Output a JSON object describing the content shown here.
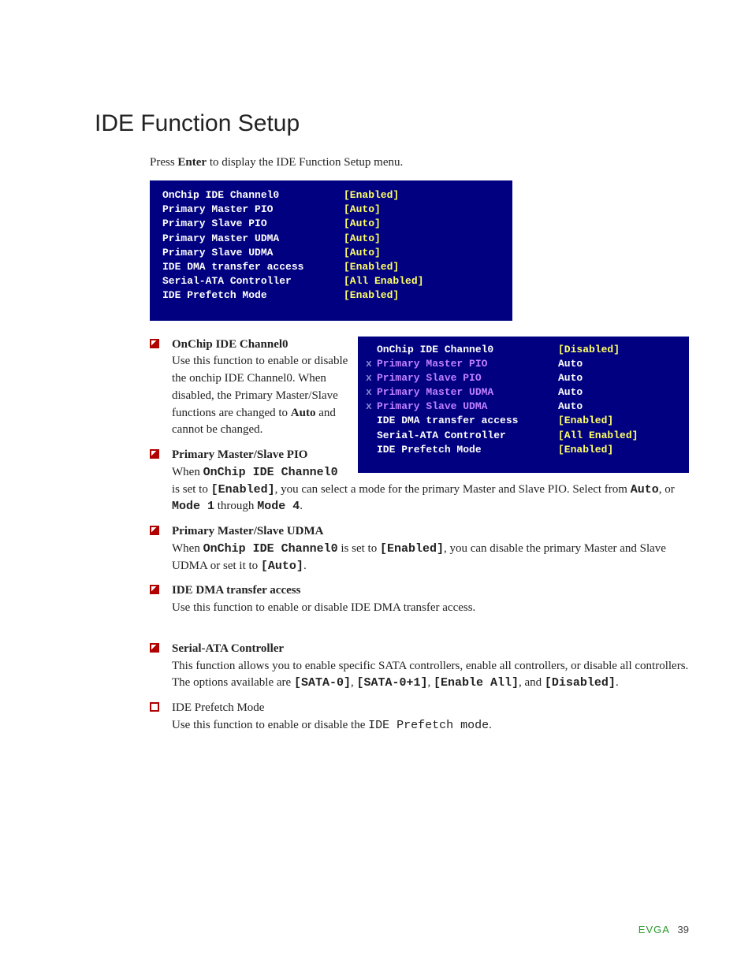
{
  "heading": "IDE Function Setup",
  "intro_pre": "Press ",
  "intro_key": "Enter",
  "intro_post": " to display the IDE Function Setup menu.",
  "box1": {
    "r0": {
      "label": "OnChip IDE Channel0",
      "val": "[Enabled]"
    },
    "r1": {
      "label": "Primary Master   PIO",
      "val": "[Auto]"
    },
    "r2": {
      "label": "Primary Slave    PIO",
      "val": "[Auto]"
    },
    "r3": {
      "label": "Primary Master   UDMA",
      "val": "[Auto]"
    },
    "r4": {
      "label": "Primary Slave    UDMA",
      "val": "[Auto]"
    },
    "r5": {
      "label": "IDE DMA transfer access",
      "val": "[Enabled]"
    },
    "r6": {
      "label": "Serial-ATA Controller",
      "val": "[All Enabled]"
    },
    "r7": {
      "label": "IDE Prefetch Mode",
      "val": "[Enabled]"
    }
  },
  "box2": {
    "r0": {
      "x": "",
      "label": "OnChip IDE Channel0",
      "val": "[Disabled]"
    },
    "r1": {
      "x": "x",
      "label": "Primary Master   PIO",
      "val": " Auto"
    },
    "r2": {
      "x": "x",
      "label": "Primary Slave    PIO",
      "val": " Auto"
    },
    "r3": {
      "x": "x",
      "label": "Primary Master   UDMA",
      "val": " Auto"
    },
    "r4": {
      "x": "x",
      "label": "Primary Slave    UDMA",
      "val": " Auto"
    },
    "r5": {
      "x": "",
      "label": "IDE DMA transfer access",
      "val": "[Enabled]"
    },
    "r6": {
      "x": "",
      "label": "Serial-ATA Controller",
      "val": "[All Enabled]"
    },
    "r7": {
      "x": "",
      "label": "IDE Prefetch Mode",
      "val": "[Enabled]"
    }
  },
  "items": {
    "onchip": {
      "title": "OnChip IDE Channel0",
      "body_a": "Use this function to enable or disable the onchip IDE Channel0. When disabled, the Primary Master/Slave functions are changed to ",
      "auto": "Auto",
      "body_b": " and cannot be changed."
    },
    "pio": {
      "title": "Primary Master/Slave PIO",
      "l1a": "When ",
      "l1b": "OnChip IDE Channel0",
      "l2a": "is set to ",
      "l2b": "[Enabled]",
      "l2c": ", you can select a mode for the primary Master and Slave PIO. Select from ",
      "l2d": "Auto",
      "l2e": ", or ",
      "l2f": "Mode 1",
      "l2g": " through ",
      "l2h": "Mode 4",
      "l2i": "."
    },
    "udma": {
      "title": "Primary Master/Slave UDMA",
      "a": "When ",
      "b": "OnChip IDE Channel0",
      "c": " is set to ",
      "d": "[Enabled]",
      "e": ", you can disable the primary Master and Slave UDMA or set it to ",
      "f": "[Auto]",
      "g": "."
    },
    "dma": {
      "title": "IDE DMA transfer access",
      "body": "Use this function to enable or disable IDE DMA transfer access."
    },
    "sata": {
      "title": "Serial-ATA Controller",
      "a": "This function allows you to enable specific SATA controllers, enable all controllers, or disable all controllers. The options available are ",
      "o1": "[SATA-0]",
      "c1": ", ",
      "o2": "[SATA-0+1]",
      "c2": ", ",
      "o3": "[Enable All]",
      "c3": ", and ",
      "o4": "[Disabled]",
      "c4": "."
    },
    "prefetch": {
      "title": "IDE Prefetch Mode",
      "a": "Use this function to enable or disable the ",
      "b": "IDE Prefetch mode",
      "c": "."
    }
  },
  "footer": {
    "brand": "EVGA",
    "page": "39"
  }
}
